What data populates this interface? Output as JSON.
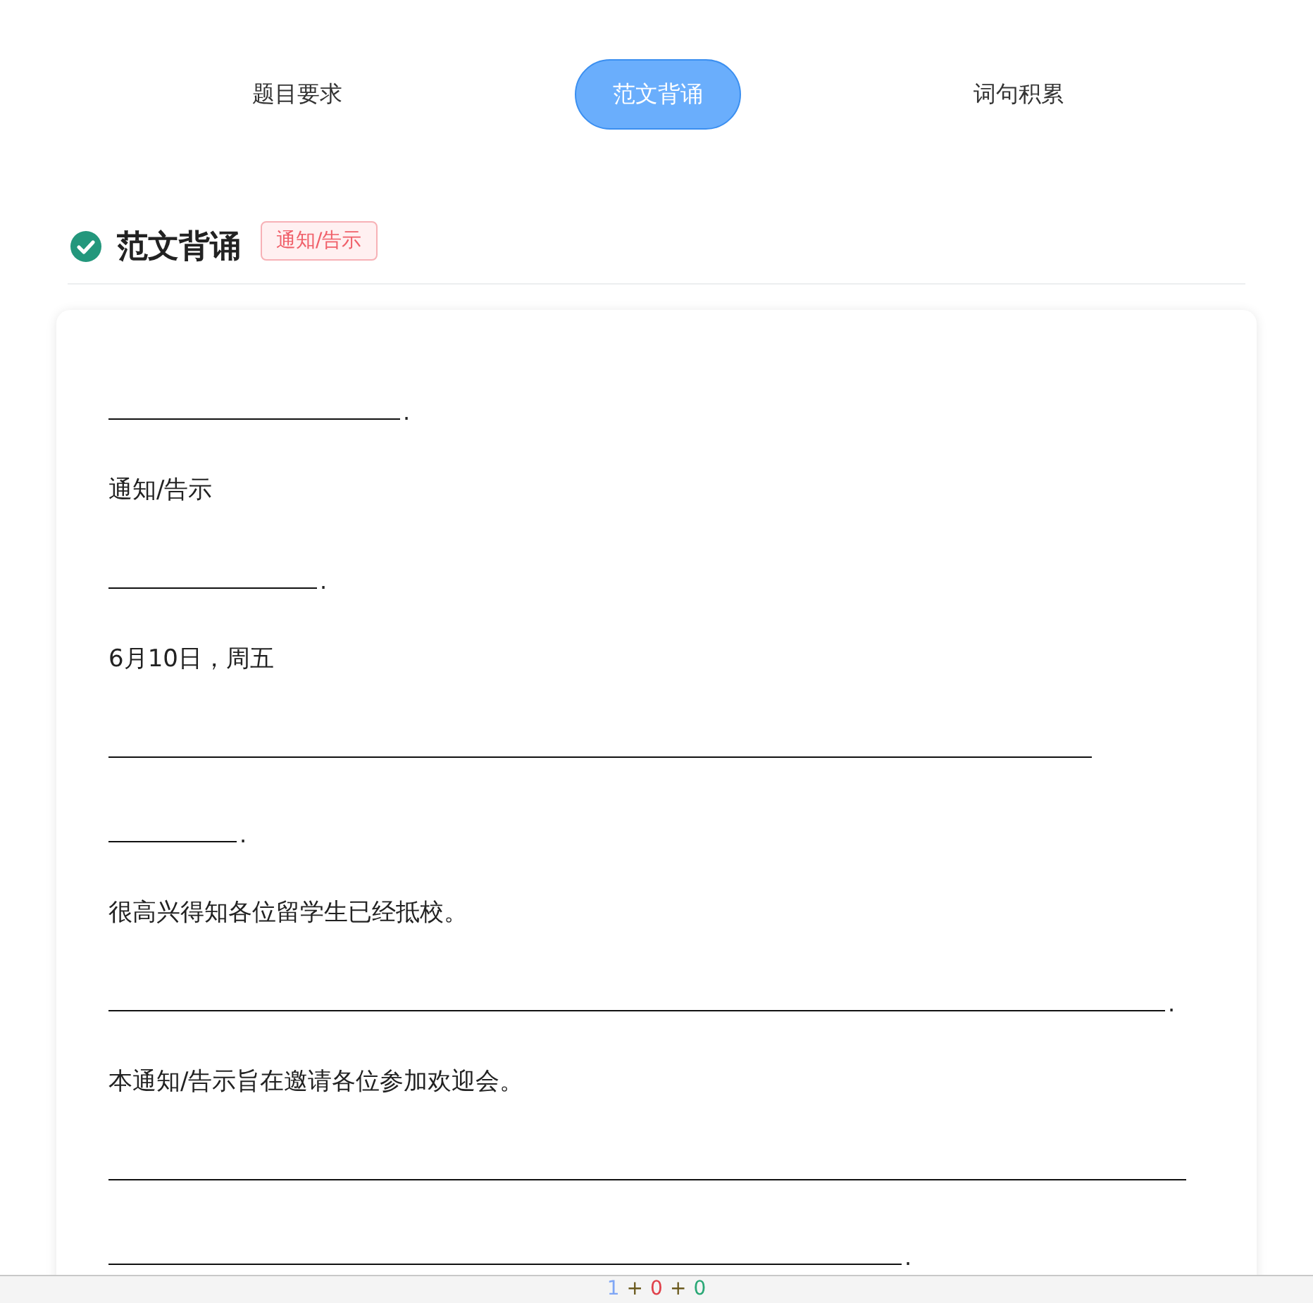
{
  "tabs": [
    {
      "label": "题目要求",
      "selected": false
    },
    {
      "label": "范文背诵",
      "selected": true
    },
    {
      "label": "词句积累",
      "selected": false
    }
  ],
  "section": {
    "title": "范文背诵",
    "tag": "通知/告示"
  },
  "lines": [
    {
      "kind": "blank",
      "end": "."
    },
    {
      "kind": "text",
      "text": "通知/告示"
    },
    {
      "kind": "blank",
      "end": "."
    },
    {
      "kind": "text",
      "text": "6月10日，周五"
    },
    {
      "kind": "blank"
    },
    {
      "kind": "blank",
      "end": "."
    },
    {
      "kind": "text",
      "text": "很高兴得知各位留学生已经抵校。"
    },
    {
      "kind": "blank",
      "end": "."
    },
    {
      "kind": "text",
      "text": "本通知/告示旨在邀请各位参加欢迎会。"
    },
    {
      "kind": "blank"
    },
    {
      "kind": "blank",
      "end": "."
    }
  ],
  "footer": [
    {
      "text": "1",
      "color": "#7fa6f5"
    },
    {
      "text": "+",
      "color": "#6b5a1e"
    },
    {
      "text": "0",
      "color": "#e0404a"
    },
    {
      "text": "+",
      "color": "#6b5a1e"
    },
    {
      "text": "0",
      "color": "#2aa876"
    }
  ]
}
